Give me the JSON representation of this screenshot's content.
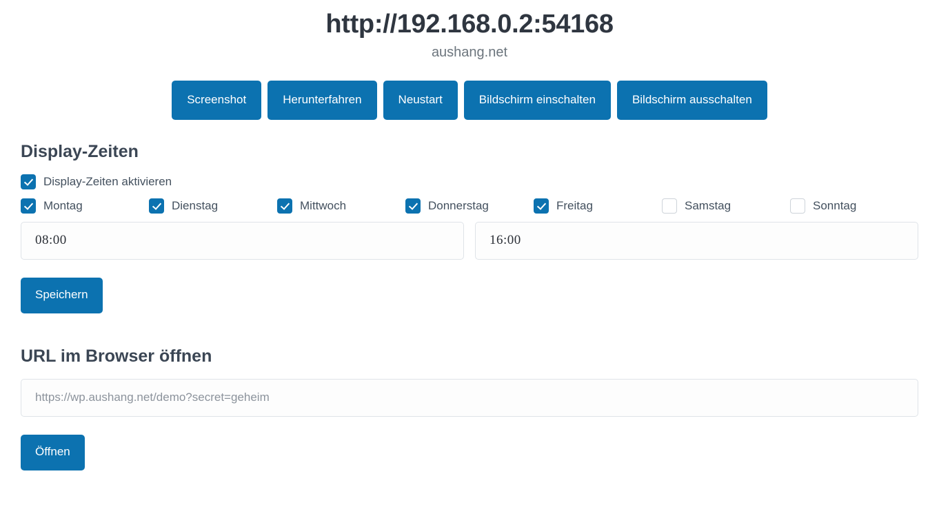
{
  "header": {
    "title": "http://192.168.0.2:54168",
    "subtitle": "aushang.net"
  },
  "actions": {
    "buttons": [
      {
        "label": "Screenshot",
        "name": "screenshot-button"
      },
      {
        "label": "Herunterfahren",
        "name": "shutdown-button"
      },
      {
        "label": "Neustart",
        "name": "restart-button"
      },
      {
        "label": "Bildschirm einschalten",
        "name": "screen-on-button"
      },
      {
        "label": "Bildschirm ausschalten",
        "name": "screen-off-button"
      }
    ]
  },
  "display_times": {
    "section_title": "Display-Zeiten",
    "enable": {
      "label": "Display-Zeiten aktivieren",
      "checked": true
    },
    "days": [
      {
        "label": "Montag",
        "checked": true
      },
      {
        "label": "Dienstag",
        "checked": true
      },
      {
        "label": "Mittwoch",
        "checked": true
      },
      {
        "label": "Donnerstag",
        "checked": true
      },
      {
        "label": "Freitag",
        "checked": true
      },
      {
        "label": "Samstag",
        "checked": false
      },
      {
        "label": "Sonntag",
        "checked": false
      }
    ],
    "start_time": {
      "value": "08:00"
    },
    "end_time": {
      "value": "16:00"
    },
    "save_label": "Speichern"
  },
  "url_section": {
    "section_title": "URL im Browser öffnen",
    "url_input": {
      "value": "",
      "placeholder": "https://wp.aushang.net/demo?secret=geheim"
    },
    "open_label": "Öffnen"
  },
  "colors": {
    "accent": "#0c72b0",
    "heading": "#3b4654",
    "title": "#2f3640",
    "subtitle": "#6c757d",
    "placeholder": "#8c939c",
    "border": "#dfe3e8"
  }
}
